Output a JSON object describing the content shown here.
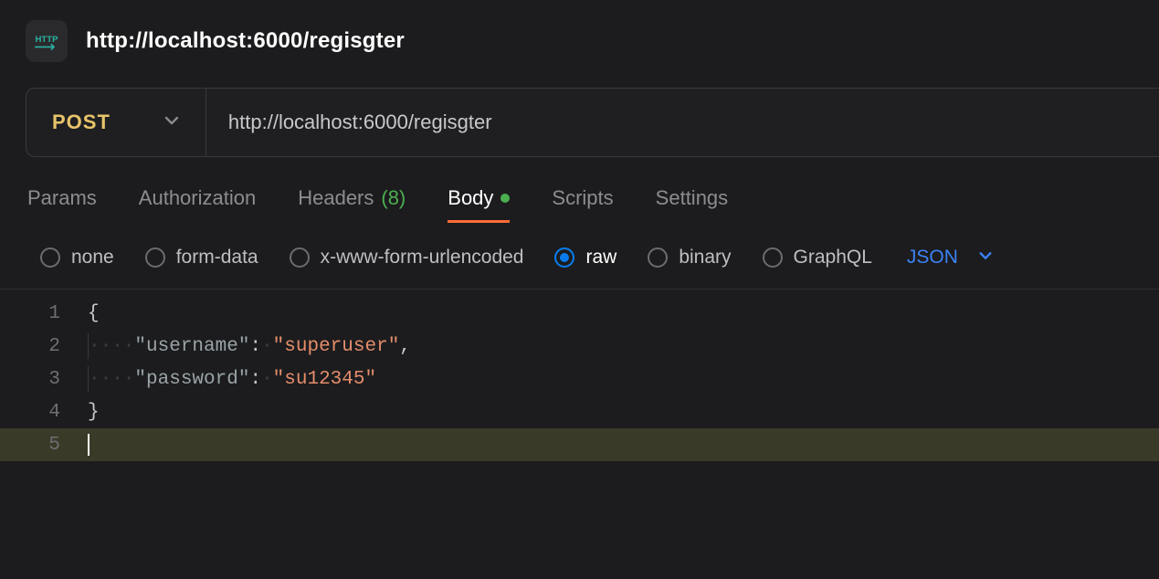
{
  "header": {
    "title": "http://localhost:6000/regisgter"
  },
  "request": {
    "method": "POST",
    "url": "http://localhost:6000/regisgter"
  },
  "tabs": {
    "params": "Params",
    "auth": "Authorization",
    "headers_label": "Headers",
    "headers_count": "(8)",
    "body": "Body",
    "scripts": "Scripts",
    "settings": "Settings"
  },
  "body_types": {
    "none": "none",
    "form_data": "form-data",
    "urlencoded": "x-www-form-urlencoded",
    "raw": "raw",
    "binary": "binary",
    "graphql": "GraphQL",
    "format": "JSON"
  },
  "editor": {
    "lines": {
      "n1": "1",
      "n2": "2",
      "n3": "3",
      "n4": "4",
      "n5": "5",
      "l1_open": "{",
      "l2_key": "\"username\"",
      "l2_val": "\"superuser\"",
      "l3_key": "\"password\"",
      "l3_val": "\"su12345\"",
      "l4_close": "}",
      "colon": ":",
      "comma": ","
    },
    "payload": {
      "username": "superuser",
      "password": "su12345"
    }
  }
}
